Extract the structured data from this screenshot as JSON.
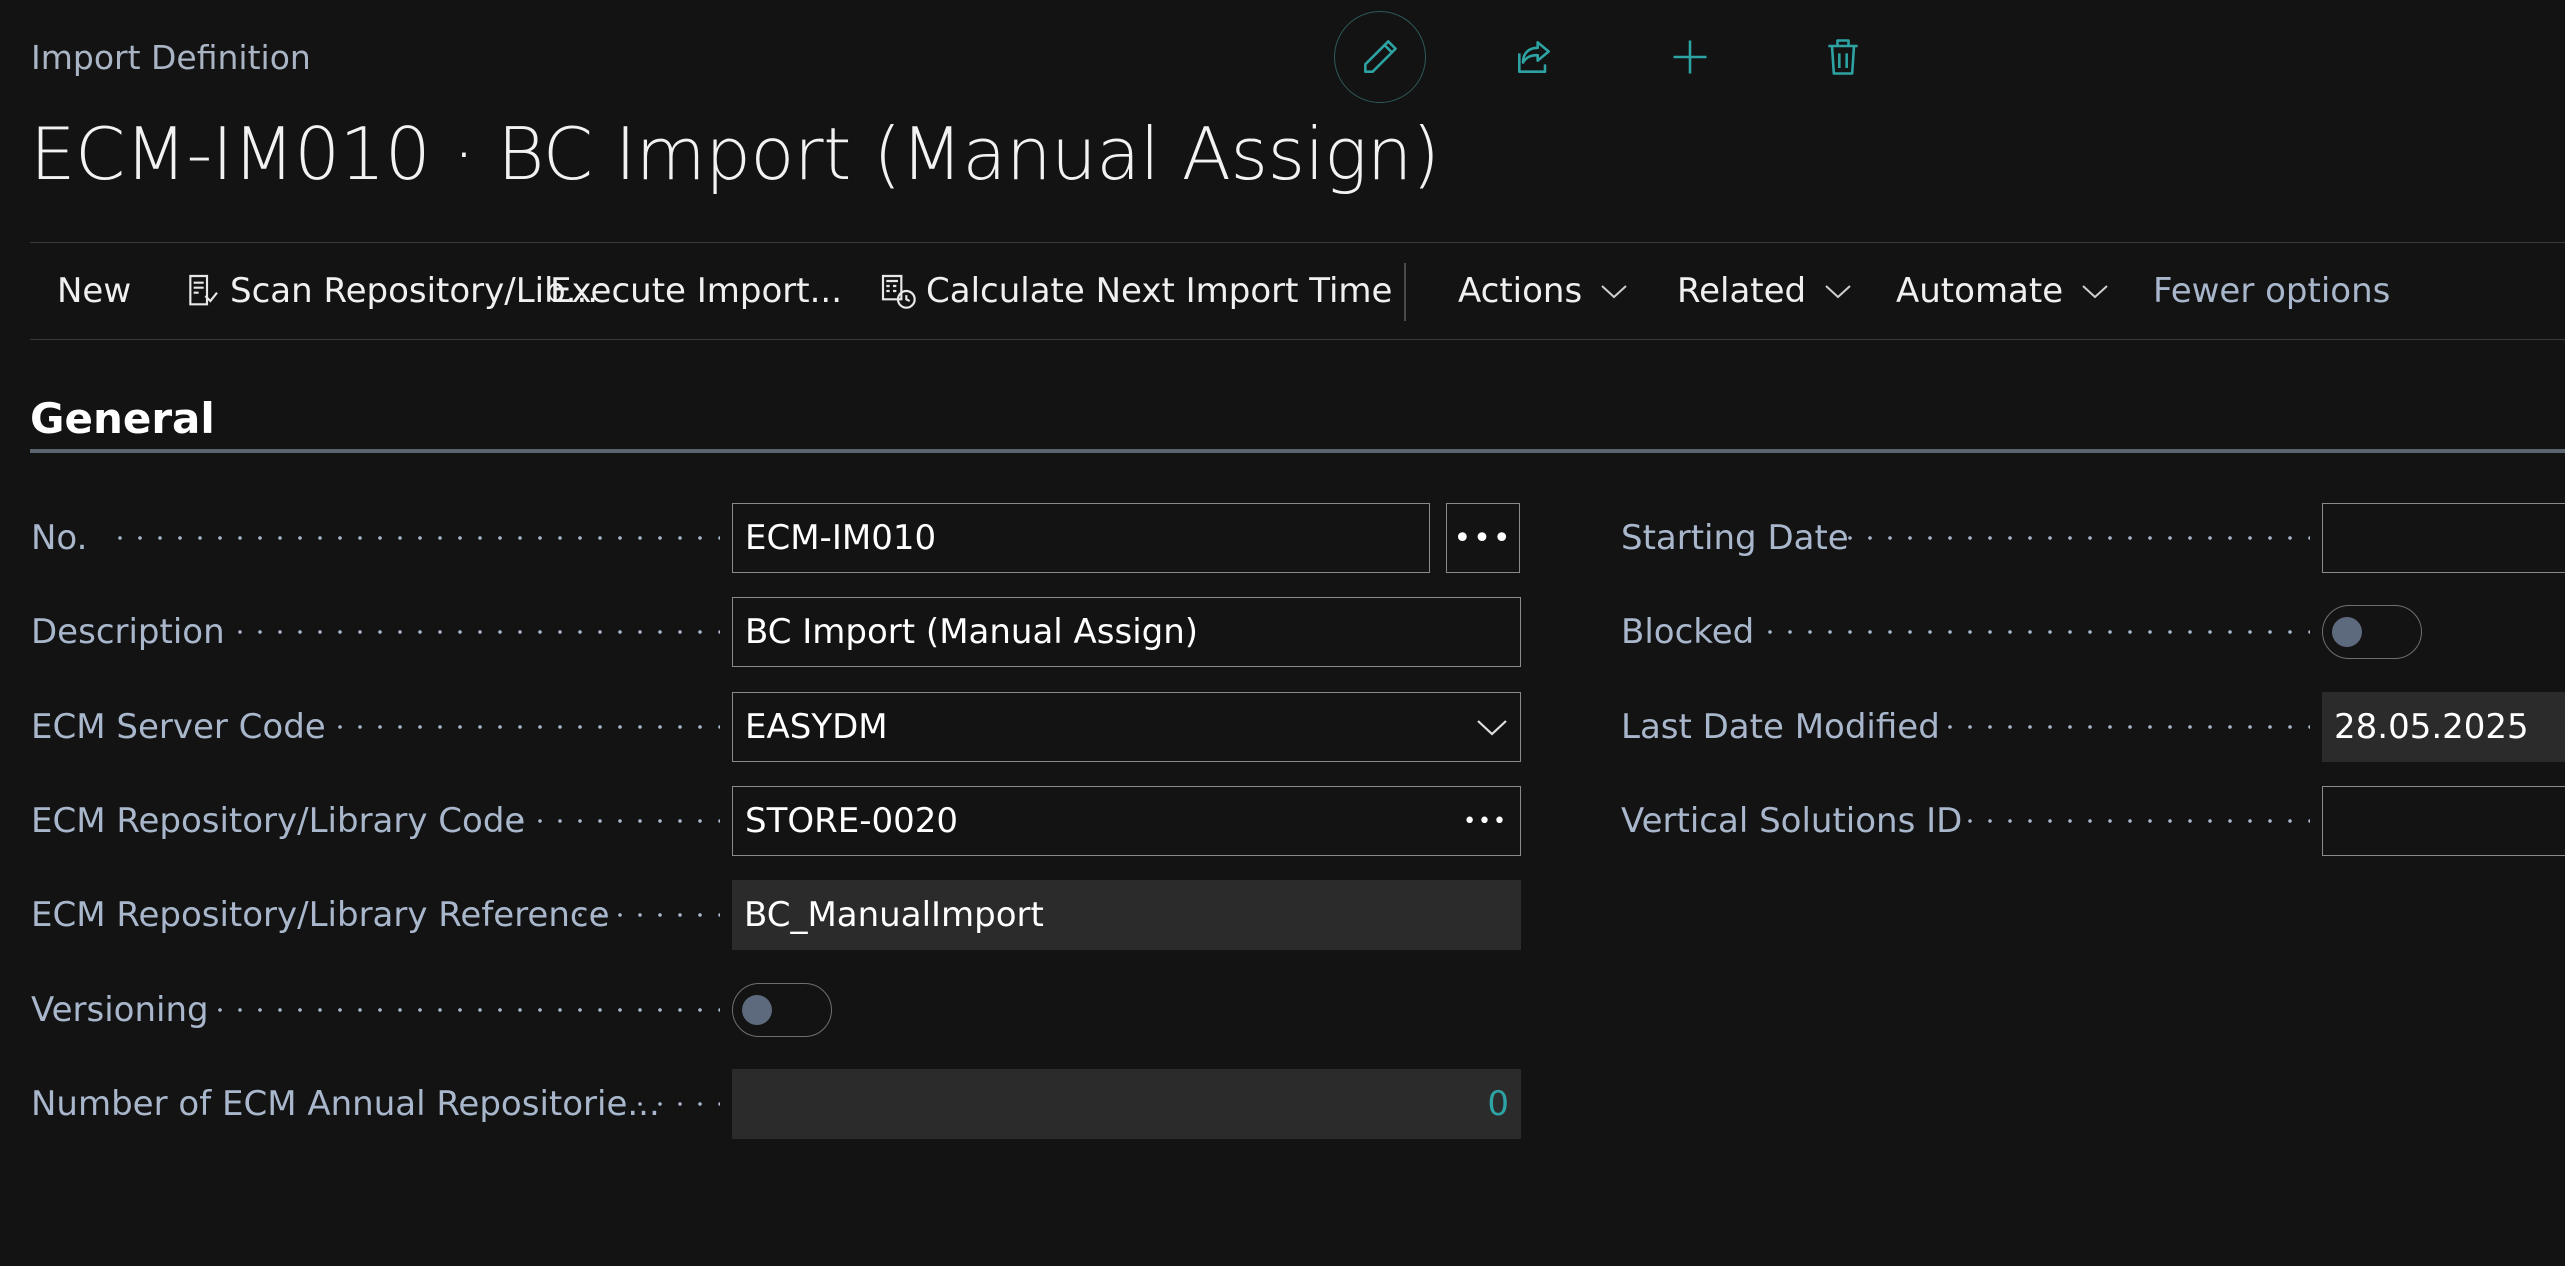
{
  "page": {
    "breadcrumb": "Import Definition",
    "title": "ECM-IM010 · BC Import (Manual Assign)"
  },
  "top_actions": [
    {
      "icon": "pencil-icon",
      "label": "Edit"
    },
    {
      "icon": "share-icon",
      "label": "Share"
    },
    {
      "icon": "plus-icon",
      "label": "New"
    },
    {
      "icon": "trash-icon",
      "label": "Delete"
    }
  ],
  "action_bar": {
    "new": "New",
    "scan": "Scan Repository/Lib...",
    "execute": "Execute Import...",
    "calculate": "Calculate Next Import Time",
    "actions": "Actions",
    "related": "Related",
    "automate": "Automate",
    "fewer_options": "Fewer options"
  },
  "section": {
    "title": "General"
  },
  "fields_left": {
    "no": {
      "label": "No.",
      "value": "ECM-IM010"
    },
    "description": {
      "label": "Description",
      "value": "BC Import (Manual Assign)"
    },
    "server_code": {
      "label": "ECM Server Code",
      "value": "EASYDM"
    },
    "repo_code": {
      "label": "ECM Repository/Library Code",
      "value": "STORE-0020"
    },
    "repo_reference": {
      "label": "ECM Repository/Library Reference",
      "value": "BC_ManualImport"
    },
    "versioning": {
      "label": "Versioning",
      "value": false
    },
    "annual_repos": {
      "label": "Number of ECM Annual Repositorie...",
      "value": "0"
    }
  },
  "fields_right": {
    "starting_date": {
      "label": "Starting Date",
      "value": ""
    },
    "blocked": {
      "label": "Blocked",
      "value": false
    },
    "last_modified": {
      "label": "Last Date Modified",
      "value": "28.05.2025"
    },
    "vertical_solutions": {
      "label": "Vertical Solutions ID",
      "value": ""
    }
  },
  "colors": {
    "background": "#131313",
    "label": "#a9b7cc",
    "accent": "#2ea3a3",
    "readonly_field": "#2b2b2b"
  }
}
